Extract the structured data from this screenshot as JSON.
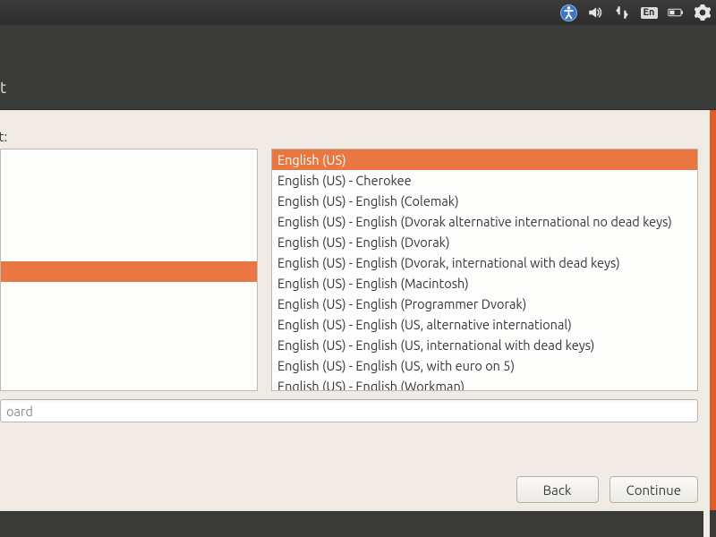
{
  "topbar": {
    "icons": [
      "accessibility-icon",
      "volume-icon",
      "network-icon",
      "input-method-icon",
      "battery-icon",
      "settings-icon"
    ],
    "input_method_label": "En"
  },
  "header": {
    "title_fragment": "t"
  },
  "hint_label": "ut:",
  "left_list": {
    "selected_index": 5
  },
  "variants": {
    "selected_index": 0,
    "items": [
      "English (US)",
      "English (US) - Cherokee",
      "English (US) - English (Colemak)",
      "English (US) - English (Dvorak alternative international no dead keys)",
      "English (US) - English (Dvorak)",
      "English (US) - English (Dvorak, international with dead keys)",
      "English (US) - English (Macintosh)",
      "English (US) - English (Programmer Dvorak)",
      "English (US) - English (US, alternative international)",
      "English (US) - English (US, international with dead keys)",
      "English (US) - English (US, with euro on 5)",
      "English (US) - English (Workman)"
    ]
  },
  "test_input": {
    "placeholder_fragment": "oard"
  },
  "buttons": {
    "back": "Back",
    "continue": "Continue"
  }
}
